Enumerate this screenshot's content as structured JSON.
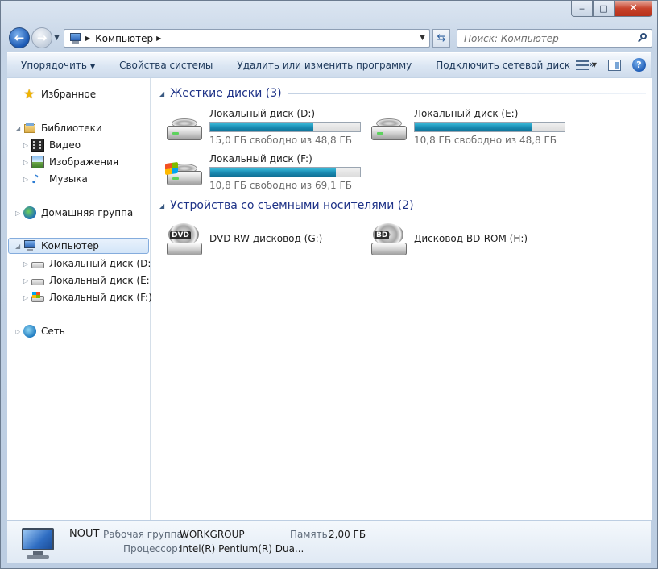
{
  "window": {
    "caption": {
      "minimize": "‒",
      "maximize": "□",
      "close": "✕"
    }
  },
  "address": {
    "location": "Компьютер",
    "search_placeholder": "Поиск: Компьютер"
  },
  "toolbar": {
    "organize": "Упорядочить",
    "system_properties": "Свойства системы",
    "uninstall": "Удалить или изменить программу",
    "map_drive": "Подключить сетевой диск",
    "more": "»"
  },
  "nav": {
    "favorites": "Избранное",
    "libraries": "Библиотеки",
    "video": "Видео",
    "images": "Изображения",
    "music": "Музыка",
    "homegroup": "Домашняя группа",
    "computer": "Компьютер",
    "drive_d": "Локальный диск (D:)",
    "drive_e": "Локальный диск (E:)",
    "drive_f": "Локальный диск (F:)",
    "network": "Сеть"
  },
  "groups": {
    "hard_disks": "Жесткие диски (3)",
    "removable": "Устройства со съемными носителями (2)"
  },
  "drives": [
    {
      "name": "Локальный диск (D:)",
      "free_text": "15,0 ГБ свободно из 48,8 ГБ",
      "used_fraction": 0.69
    },
    {
      "name": "Локальный диск (E:)",
      "free_text": "10,8 ГБ свободно из 48,8 ГБ",
      "used_fraction": 0.78
    },
    {
      "name": "Локальный диск (F:)",
      "free_text": "10,8 ГБ свободно из 69,1 ГБ",
      "used_fraction": 0.84
    }
  ],
  "optical": [
    {
      "name": "DVD RW дисковод (G:)",
      "badge": "DVD"
    },
    {
      "name": "Дисковод BD-ROM (H:)",
      "badge": "BD"
    }
  ],
  "details": {
    "computer_name": "NOUT",
    "workgroup_label": "Рабочая группа:",
    "workgroup_value": "WORKGROUP",
    "memory_label": "Память:",
    "memory_value": "2,00 ГБ",
    "cpu_label": "Процессор:",
    "cpu_value": "Intel(R) Pentium(R) Dua..."
  }
}
